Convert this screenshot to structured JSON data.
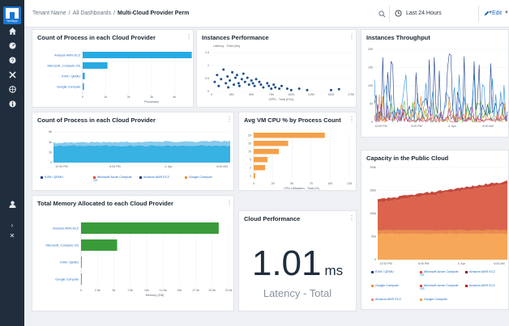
{
  "nav": {
    "logo_text": "NetApp",
    "items": [
      "home-icon",
      "gauge-icon",
      "question-icon",
      "tools-icon",
      "globe-icon",
      "info-icon"
    ],
    "bottom": [
      "user-icon",
      "expand-icon",
      "collapse-icon"
    ]
  },
  "header": {
    "breadcrumb": [
      "Tenant Name",
      "All Dashboards",
      "Multi-Cloud Provider Perm"
    ],
    "separator": "/",
    "time_range": "Last 24 Hours",
    "edit_label": "Edit"
  },
  "widgets": {
    "w1": {
      "title": "Count of Process in each Cloud Provider",
      "chart_data": {
        "type": "bar",
        "orientation": "horizontal",
        "categories": [
          "Amazon AWS EC2",
          "Microsoft...Compute OS",
          "KVM / QEMU",
          "Google Compute"
        ],
        "values": [
          4750,
          1080,
          90,
          60
        ],
        "xlabel": "Processes",
        "xticks": [
          "0",
          "1k",
          "2k",
          "3k",
          "4k",
          "5k",
          "6k"
        ],
        "xlim": [
          0,
          6000
        ],
        "colors": [
          "#27aae1",
          "#27aae1",
          "#27aae1",
          "#27aae1"
        ]
      }
    },
    "w2": {
      "title": "Instances Performance",
      "chart_data": {
        "type": "scatter",
        "xlabel": "IOPS - Total (IO/s)",
        "ylabel": "Latency - Total (ms)",
        "xticks": [
          "0",
          "250",
          "500",
          "750",
          "1000",
          "1250",
          "1500",
          "1750"
        ],
        "yticks": [
          "0",
          "0.5",
          "1",
          "1.5"
        ],
        "xlim": [
          0,
          1750
        ],
        "ylim": [
          0,
          1.6
        ],
        "x": [
          40,
          70,
          90,
          120,
          150,
          180,
          200,
          210,
          230,
          260,
          280,
          300,
          320,
          340,
          350,
          380,
          400,
          420,
          450,
          470,
          500,
          520,
          540,
          560,
          600,
          620,
          650,
          700,
          720,
          750,
          780,
          800,
          850,
          880,
          950,
          1000,
          1100,
          1200,
          1500,
          1600
        ],
        "y": [
          0.35,
          0.6,
          0.2,
          0.45,
          0.8,
          0.3,
          0.55,
          0.15,
          0.4,
          0.7,
          0.25,
          0.5,
          0.6,
          0.3,
          0.2,
          0.45,
          0.65,
          0.35,
          0.5,
          0.25,
          0.4,
          0.3,
          0.2,
          0.45,
          0.35,
          0.25,
          0.15,
          0.3,
          0.2,
          0.1,
          0.25,
          0.15,
          0.1,
          0.2,
          0.1,
          0.05,
          0.1,
          0.05,
          0.05,
          0.08
        ],
        "color": "#1f4e8c"
      }
    },
    "w3": {
      "title": "Instances Throughput",
      "chart_data": {
        "type": "line",
        "xticks": [
          "12:00 PM",
          "6:00 PM",
          "4. Apr",
          "6:00 AM"
        ],
        "yticks": [
          "0",
          "50",
          "100",
          "150",
          "200"
        ],
        "ylim": [
          0,
          200
        ],
        "series": [
          {
            "color": "#1f3f8c"
          },
          {
            "color": "#2b8fd6"
          },
          {
            "color": "#f28e2b"
          },
          {
            "color": "#6cb33f"
          },
          {
            "color": "#8e44ad"
          },
          {
            "color": "#e74c3c"
          }
        ]
      }
    },
    "w4": {
      "title": "Count of Process in each Cloud Provider",
      "chart_data": {
        "type": "area",
        "xticks": [
          "12:00 PM",
          "6:00 PM",
          "4. Apr",
          "6:00 AM"
        ],
        "yticks": [
          "0",
          "2k",
          "4k",
          "6k"
        ],
        "ylim": [
          0,
          6000
        ],
        "series": [
          {
            "name": "KVM / QEMU",
            "color": "#1f3f8c"
          },
          {
            "name": "Microsoft Azure Compute OS",
            "color": "#e74c3c"
          },
          {
            "name": "Amazon AWS EC2",
            "color": "#27aae1"
          },
          {
            "name": "Google Compute",
            "color": "#f28e2b"
          }
        ]
      }
    },
    "w5": {
      "title": "Avg VM CPU % by Process Count",
      "chart_data": {
        "type": "bar",
        "orientation": "horizontal",
        "categories": [
          "20",
          "15",
          "10",
          "5",
          "2",
          "1"
        ],
        "values": [
          93,
          45,
          33,
          18,
          15,
          2
        ],
        "xlabel": "CPU Utilization - Total (%)",
        "xticks": [
          "0",
          "25",
          "50",
          "75",
          "100",
          "125"
        ],
        "xlim": [
          0,
          125
        ],
        "color": "#f5a04a"
      }
    },
    "w6": {
      "title": "Capacity in the Public Cloud",
      "chart_data": {
        "type": "area",
        "xticks": [
          "12:00 PM",
          "6:00 PM",
          "4. Apr",
          "6:00 AM"
        ],
        "yticks": [
          "0",
          "50k",
          "100k",
          "150k",
          "200k"
        ],
        "ylim": [
          0,
          200000
        ],
        "series": [
          {
            "name": "KVM / QEMU",
            "color": "#1f3f8c"
          },
          {
            "name": "Microsoft Azure Compute OS",
            "color": "#e74c3c"
          },
          {
            "name": "Amazon AWS EC2",
            "color": "#8b1a1a"
          },
          {
            "name": "Google Compute",
            "color": "#f28e2b"
          },
          {
            "name": "Microsoft Azure Compute OS",
            "color": "#e74c3c"
          },
          {
            "name": "Amazon AWS EC2",
            "color": "#b71c1c"
          },
          {
            "name": "Amazon AWS EC2",
            "color": "#f08a8a"
          },
          {
            "name": "Google Compute",
            "color": "#f5a04a"
          }
        ]
      }
    },
    "w7": {
      "title": "Total Memory Allocated to each Cloud Provider",
      "chart_data": {
        "type": "bar",
        "orientation": "horizontal",
        "categories": [
          "Amazon AWS EC2",
          "Microsoft...Compute OS",
          "KVM / QEMU",
          "Google Compute"
        ],
        "values": [
          21000,
          5500,
          80,
          50
        ],
        "xlabel": "Memory (GB)",
        "xticks": [
          "0",
          "2.5k",
          "5k",
          "7.5k",
          "10k",
          "12.5k",
          "15k",
          "17.5k",
          "20.0k",
          "22.5k"
        ],
        "xlim": [
          0,
          22500
        ],
        "color": "#3a9b3a"
      }
    },
    "w8": {
      "title": "Cloud Performance",
      "value": "1.01",
      "unit": "ms",
      "subtitle": "Latency - Total"
    }
  }
}
